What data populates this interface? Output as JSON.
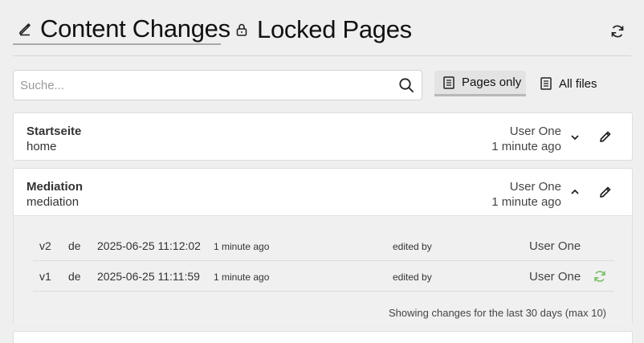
{
  "header": {
    "tabs": [
      {
        "label": "Content Changes",
        "icon": "pencil-icon"
      },
      {
        "label": "Locked Pages",
        "icon": "lock-icon"
      }
    ],
    "refresh_icon": "refresh-icon"
  },
  "search": {
    "placeholder": "Suche...",
    "value": "",
    "icon": "search-icon"
  },
  "filters": [
    {
      "label": "Pages only",
      "icon": "page-icon",
      "selected": true
    },
    {
      "label": "All files",
      "icon": "files-icon",
      "selected": false
    }
  ],
  "pages": [
    {
      "title": "Startseite",
      "slug": "home",
      "user": "User One",
      "time": "1 minute ago",
      "expanded": false
    },
    {
      "title": "Mediation",
      "slug": "mediation",
      "user": "User One",
      "time": "1 minute ago",
      "expanded": true,
      "versions": [
        {
          "version": "v2",
          "lang": "de",
          "date": "2025-06-25 11:12:02",
          "relative": "1 minute ago",
          "edited_by_label": "edited by",
          "user": "User One",
          "restorable": false
        },
        {
          "version": "v1",
          "lang": "de",
          "date": "2025-06-25 11:11:59",
          "relative": "1 minute ago",
          "edited_by_label": "edited by",
          "user": "User One",
          "restorable": true
        }
      ],
      "footer_note": "Showing changes for the last 30 days (max 10)"
    }
  ],
  "colors": {
    "restore_icon": "#7bbf6a",
    "background": "#efefef"
  }
}
